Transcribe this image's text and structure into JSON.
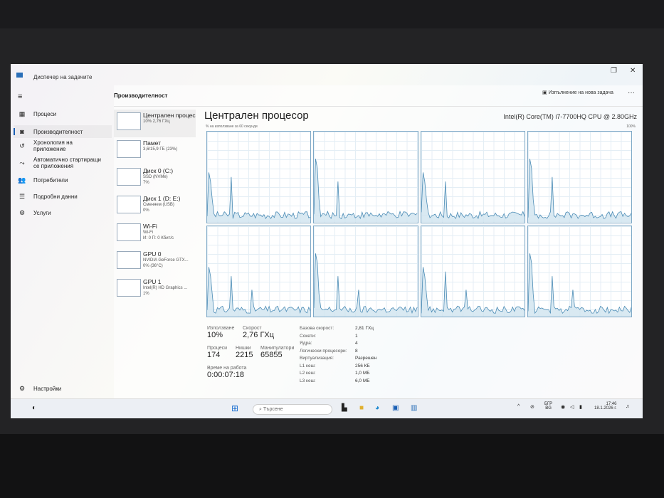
{
  "window": {
    "title": "Диспечер на задачите",
    "restore": "❐",
    "close": "✕"
  },
  "sidebar": {
    "menu": "≡",
    "items": [
      {
        "label": "Процеси",
        "icon": "▦"
      },
      {
        "label": "Производителност",
        "icon": "◙"
      },
      {
        "label": "Хронология на приложение",
        "icon": "↺"
      },
      {
        "label": "Автоматично стартиращи се приложения",
        "icon": "⤳"
      },
      {
        "label": "Потребители",
        "icon": "👥"
      },
      {
        "label": "Подробни данни",
        "icon": "☰"
      },
      {
        "label": "Услуги",
        "icon": "⚙"
      }
    ],
    "settings": {
      "label": "Настройки",
      "icon": "⚙"
    }
  },
  "header": {
    "title": "Производителност",
    "new_task": "Изпълнение на нова задача",
    "more": "···"
  },
  "resources": [
    {
      "name": "Централен процесор",
      "line1": "10% 2,76 ГХц",
      "line2": ""
    },
    {
      "name": "Памет",
      "line1": "3,6/15,9 ГБ (23%)",
      "line2": ""
    },
    {
      "name": "Диск 0 (C:)",
      "line1": "SSD (NVMe)",
      "line2": "7%"
    },
    {
      "name": "Диск 1 (D: E:)",
      "line1": "Сменяем (USB)",
      "line2": "0%"
    },
    {
      "name": "Wi-Fi",
      "line1": "Wi-Fi",
      "line2": "И: 0 П: 0 Кбит/с"
    },
    {
      "name": "GPU 0",
      "line1": "NVIDIA GeForce GTX...",
      "line2": "0% (36°C)"
    },
    {
      "name": "GPU 1",
      "line1": "Intel(R) HD Graphics ...",
      "line2": "1%"
    }
  ],
  "main": {
    "title": "Централен процесор",
    "cpu_model": "Intel(R) Core(TM) i7-7700HQ CPU @ 2.80GHz",
    "graph_label": "% на използване за 60 секунди",
    "max_label": "100%"
  },
  "stats": {
    "utilization_label": "Използване",
    "utilization": "10%",
    "speed_label": "Скорост",
    "speed": "2,76 ГХц",
    "processes_label": "Процеси",
    "processes": "174",
    "threads_label": "Нишки",
    "threads": "2215",
    "handles_label": "Манипулатори",
    "handles": "65855",
    "uptime_label": "Време на работа",
    "uptime": "0:00:07:18",
    "details": [
      {
        "k": "Базова скорост:",
        "v": "2,81 ГХц"
      },
      {
        "k": "Сокети:",
        "v": "1"
      },
      {
        "k": "Ядра:",
        "v": "4"
      },
      {
        "k": "Логически процесори:",
        "v": "8"
      },
      {
        "k": "Виртуализация:",
        "v": "Разрешен"
      },
      {
        "k": "L1 кеш:",
        "v": "256 КБ"
      },
      {
        "k": "L2 кеш:",
        "v": "1,0 МБ"
      },
      {
        "k": "L3 кеш:",
        "v": "6,0 МБ"
      }
    ]
  },
  "taskbar": {
    "search_placeholder": "Търсене",
    "lang1": "БГР",
    "lang2": "BG",
    "time": "17:46",
    "date": "18.1.2026 г."
  },
  "colors": {
    "accent": "#1a5fb4",
    "graph_line": "#4a8bb5",
    "graph_fill": "#cfe3ef"
  }
}
